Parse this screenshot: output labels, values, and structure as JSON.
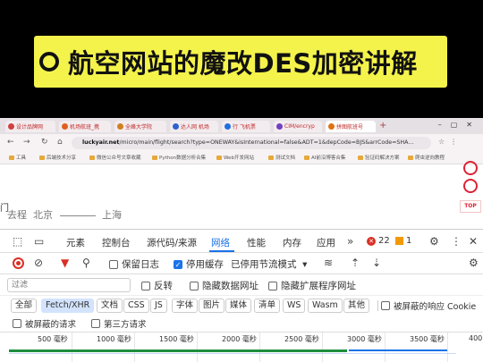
{
  "banner": {
    "title": "航空网站的魔改DES加密讲解"
  },
  "browser": {
    "tabs": [
      {
        "label": "设计品牌网",
        "color": "#d04040"
      },
      {
        "label": "机场航班_携",
        "color": "#e06020"
      },
      {
        "label": "全峰大学院",
        "color": "#d08020"
      },
      {
        "label": "达人网 机场",
        "color": "#3060d0"
      },
      {
        "label": "行 飞机票",
        "color": "#2070e0"
      },
      {
        "label": "CIM/encryp",
        "color": "#7040c0"
      },
      {
        "label": "拼图航班号",
        "color": "#e07010"
      }
    ],
    "url_domain": "luckyair.net",
    "url_path": "/micro/main/flight/search?type=ONEWAY&isInternational=false&ADT=1&depCode=BJS&arrCode=SHA...",
    "bookmarks": [
      "工具",
      "后端技术分享",
      "微信公众号文章收藏",
      "Python数据分析合集",
      "Web开发网站",
      "测试文档",
      "AI前沿博客合集",
      "验证码解决方案",
      "爬虫逆向教程"
    ]
  },
  "page": {
    "route_tag": "门",
    "route_label": "去程",
    "origin": "北京",
    "destination": "上海",
    "top_label": "TOP"
  },
  "devtools": {
    "tabs": [
      "元素",
      "控制台",
      "源代码/来源",
      "网络",
      "性能",
      "内存",
      "应用"
    ],
    "active_tab": "网络",
    "error_count": "22",
    "warning_count": "1",
    "toolbar": {
      "preserve_log": "保留日志",
      "disable_cache": "停用缓存",
      "throttling": "已停用节流模式"
    },
    "filter": {
      "placeholder": "过滤",
      "invert": "反转",
      "hide_data_urls": "隐藏数据网址",
      "hide_ext_urls": "隐藏扩展程序网址"
    },
    "types": [
      "全部",
      "Fetch/XHR",
      "文档",
      "CSS",
      "JS",
      "字体",
      "图片",
      "媒体",
      "清单",
      "WS",
      "Wasm",
      "其他"
    ],
    "active_type": "Fetch/XHR",
    "blocked_response_cookies": "被屏蔽的响应 Cookie",
    "blocked_requests": "被屏蔽的请求",
    "third_party_requests": "第三方请求",
    "timeline_ticks": [
      "500 毫秒",
      "1000 毫秒",
      "1500 毫秒",
      "2000 毫秒",
      "2500 毫秒",
      "3000 毫秒",
      "3500 毫秒",
      "400"
    ]
  }
}
